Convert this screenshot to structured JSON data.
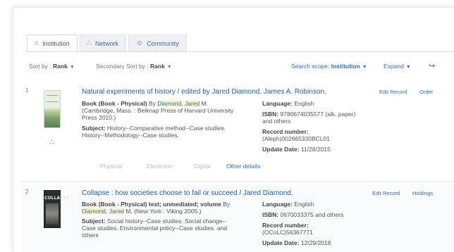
{
  "tabs": [
    {
      "label": "Institution",
      "icon": "home-icon"
    },
    {
      "label": "Network",
      "icon": "network-icon"
    },
    {
      "label": "Community",
      "icon": "community-icon"
    }
  ],
  "sort": {
    "sort_by_label": "Sort by :",
    "sort_by_value": "Rank",
    "secondary_label": "Secondary Sort by :",
    "secondary_value": "Rank",
    "scope_label": "Search scope:",
    "scope_value": "Institution",
    "expand_label": "Expand"
  },
  "records": [
    {
      "number": "1",
      "title_prefix": "Natural experiments of history / edited by",
      "title_author1": "Jared Diamond",
      "title_sep": ",",
      "title_author2": "James A. Robinson.",
      "type_line": "Book (Book - Physical)",
      "by": "By",
      "author_last": "Diamond",
      "author_first": "Jared",
      "author_suffix": "M.",
      "pub": "(Cambridge, Mass. : Belknap Press of Harvard University Press 2010.)",
      "subject_label": "Subject:",
      "subject": "History--Comparative method--Case studies. History--Methodology--Case studies.",
      "language_label": "Language:",
      "language": "English",
      "isbn_label": "ISBN:",
      "isbn": "9780674035577 (alk. paper) and others",
      "recnum_label": "Record number:",
      "recnum": "(Aleph)002665330BCL01",
      "update_label": "Update Date:",
      "update": "11/28/2015",
      "actions": [
        "Edit Record",
        "Order"
      ],
      "availability": [
        "Physical",
        "Electronic",
        "Digital"
      ],
      "other_details": "Other details",
      "cover_text": ""
    },
    {
      "number": "2",
      "title_prefix": "Collapse : how societies choose to fail or succeed /",
      "title_author1": "Jared Diamond",
      "title_sep": ".",
      "title_author2": "",
      "type_line": "Book (Book - Physical) text; unmediated; volume",
      "by": "By",
      "author_last": "Diamond",
      "author_first": "Jared",
      "author_suffix": "M. (New York : Viking 2005.)",
      "subject_label": "Subject:",
      "subject": "Social history--Case studies. Social change--Case studies. Environmental policy--Case studies. and others",
      "language_label": "Language:",
      "language": "English",
      "isbn_label": "ISBN:",
      "isbn": "0670033375 and others",
      "recnum_label": "Record number:",
      "recnum": "(OCoLC)56367771",
      "update_label": "Update Date:",
      "update": "12/29/2018",
      "actions": [
        "Edit Record",
        "Holdings"
      ],
      "cover_text": "COLLAPSE"
    }
  ],
  "colors": {
    "link": "#2f6fc0",
    "title": "#1f5fb4",
    "highlight": "#fff3c4"
  }
}
